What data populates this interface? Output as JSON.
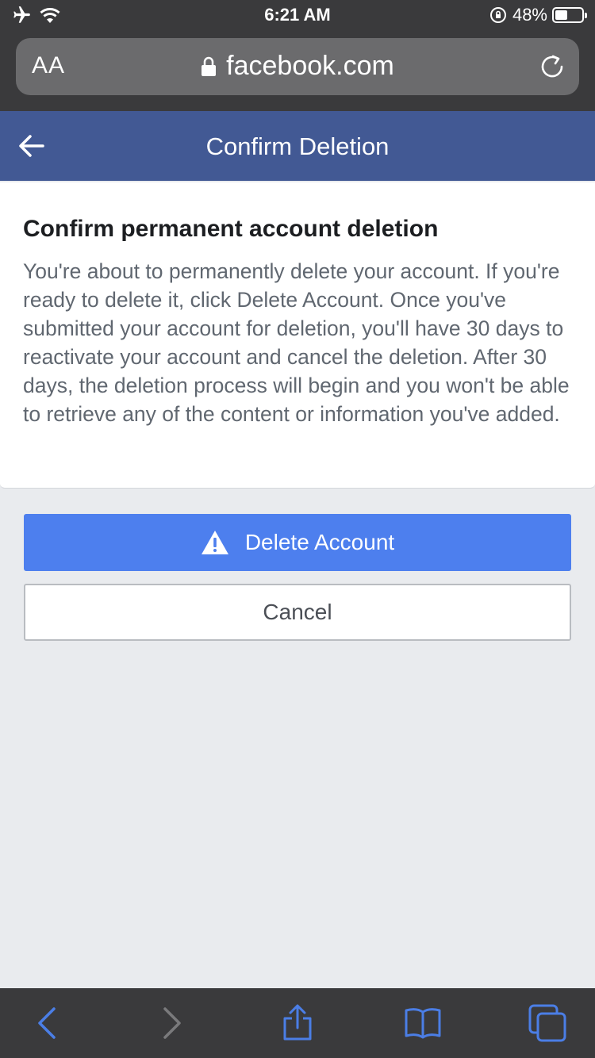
{
  "status_bar": {
    "time": "6:21 AM",
    "battery_percent": "48%",
    "battery_level": 0.48,
    "icons": [
      "airplane-icon",
      "wifi-icon",
      "rotation-lock-icon",
      "battery-icon"
    ]
  },
  "browser": {
    "text_size_label": "AA",
    "url": "facebook.com",
    "icons": [
      "lock-icon",
      "reload-icon"
    ]
  },
  "header": {
    "title": "Confirm Deletion",
    "background_color": "#425994"
  },
  "card": {
    "title": "Confirm permanent account deletion",
    "body": "You're about to permanently delete your account. If you're ready to delete it, click Delete Account. Once you've submitted your account for deletion, you'll have 30 days to reactivate your account and cancel the deletion. After 30 days, the deletion process will begin and you won't be able to retrieve any of the content or information you've added."
  },
  "actions": {
    "delete_label": "Delete Account",
    "delete_color": "#4d7fee",
    "cancel_label": "Cancel"
  },
  "toolbar": {
    "icons": [
      "back-icon",
      "forward-icon",
      "share-icon",
      "bookmarks-icon",
      "tabs-icon"
    ],
    "accent_color": "#4b7ee6"
  }
}
